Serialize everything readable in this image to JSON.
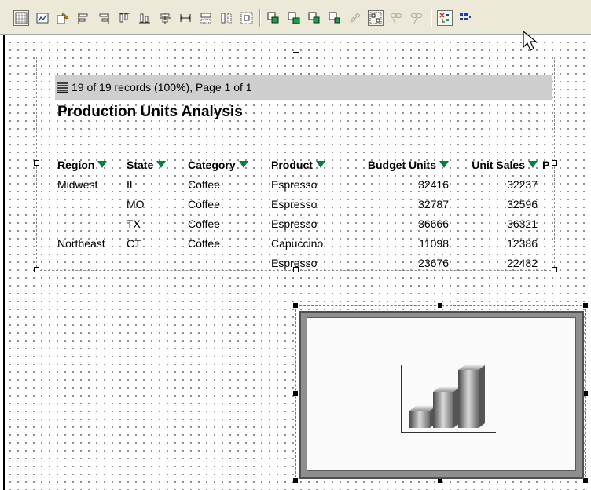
{
  "toolbar": {
    "buttons": [
      {
        "name": "grid-view-icon"
      },
      {
        "name": "chart-wizard-icon"
      },
      {
        "name": "properties-icon"
      },
      {
        "name": "align-left-icon"
      },
      {
        "name": "align-right-icon"
      },
      {
        "name": "align-top-icon"
      },
      {
        "name": "align-bottom-icon"
      },
      {
        "name": "align-middle-icon"
      },
      {
        "name": "same-width-icon"
      },
      {
        "name": "same-height-icon"
      },
      {
        "name": "same-size-icon"
      },
      {
        "name": "center-icon"
      },
      {
        "name": "bring-to-front-icon"
      },
      {
        "name": "send-to-back-icon"
      },
      {
        "name": "bring-forward-icon"
      },
      {
        "name": "send-backward-icon"
      },
      {
        "name": "link-icon"
      },
      {
        "name": "group-icon"
      },
      {
        "name": "join-icon"
      },
      {
        "name": "unjoin-icon"
      },
      {
        "name": "drill-down-icon"
      },
      {
        "name": "layout-icon"
      }
    ]
  },
  "report": {
    "status": "19 of 19 records (100%), Page 1 of 1",
    "title": "Production Units Analysis",
    "columns": [
      "Region",
      "State",
      "Category",
      "Product",
      "Budget Units",
      "Unit Sales",
      "P"
    ],
    "rows": [
      [
        "Midwest",
        "IL",
        "Coffee",
        "Espresso",
        "32416",
        "32237"
      ],
      [
        "",
        "MO",
        "Coffee",
        "Espresso",
        "32787",
        "32596"
      ],
      [
        "",
        "TX",
        "Coffee",
        "Espresso",
        "36666",
        "36321"
      ],
      [
        "Northeast",
        "CT",
        "Coffee",
        "Capuccino",
        "11098",
        "12386"
      ],
      [
        "",
        "",
        "",
        "Espresso",
        "23676",
        "22482"
      ]
    ]
  },
  "chart": {
    "icon": "bar-chart-icon"
  },
  "colors": {
    "filter": "#0a7d3e",
    "status_bg": "#cfcfcf",
    "toolbar_bg": "#ece9d8"
  }
}
